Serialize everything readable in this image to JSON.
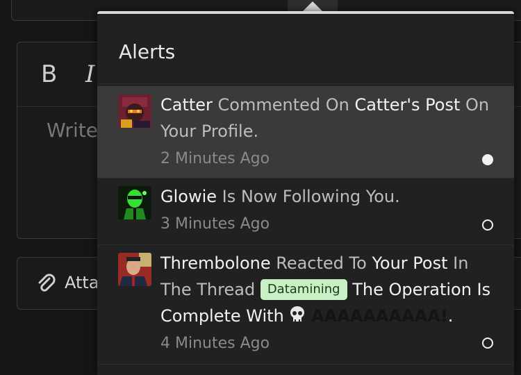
{
  "editor": {
    "bold_label": "B",
    "italic_label": "I",
    "placeholder": "Write",
    "attach_label": "Atta"
  },
  "alerts_menu": {
    "title": "Alerts",
    "items": [
      {
        "user": "Catter",
        "part1": " Commented On ",
        "link": "Catter's Post",
        "part2": " On Your Profile.",
        "time": "2 Minutes Ago",
        "state": "unread"
      },
      {
        "user": "Glowie",
        "part1": " Is Now Following You.",
        "time": "3 Minutes Ago",
        "state": "read"
      },
      {
        "user": "Thrembolone",
        "part1": " Reacted To ",
        "link": "Your Post",
        "part2": " In The Thread ",
        "tag": "Datamining",
        "part3": " The Operation Is Complete With ",
        "emoji": "skull-emoji",
        "shout": "AAAAAAAAAA!",
        "end": ".",
        "time": "4 Minutes Ago",
        "state": "read"
      }
    ]
  },
  "colors": {
    "menu_bg": "#212121",
    "unread_bg": "#3a3a3a",
    "tag_bg": "#c9f0c4",
    "tag_text": "#1d3a1a"
  }
}
